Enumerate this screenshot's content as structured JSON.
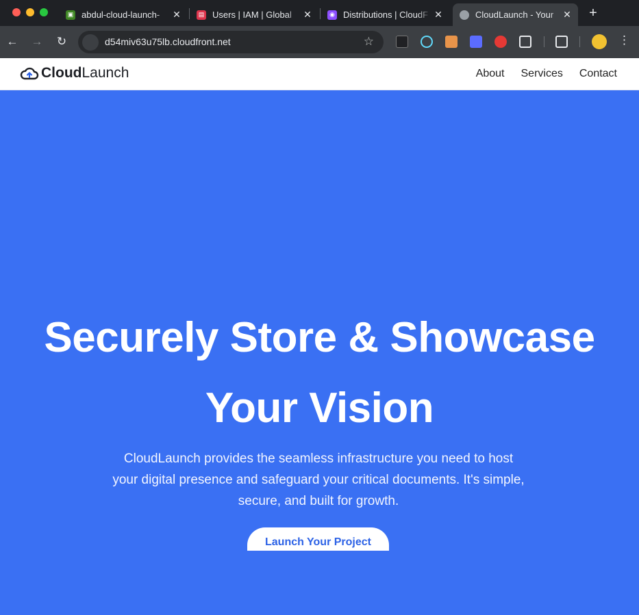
{
  "browser": {
    "tabs": [
      {
        "title": "abdul-cloud-launch-",
        "favicon": "s3-bucket-icon",
        "favicon_color": "#3f8624"
      },
      {
        "title": "Users | IAM | Global",
        "favicon": "iam-icon",
        "favicon_color": "#dd344c"
      },
      {
        "title": "Distributions | CloudF",
        "favicon": "cloudfront-icon",
        "favicon_color": "#8c4fff"
      },
      {
        "title": "CloudLaunch - Your",
        "favicon": "globe-icon",
        "favicon_color": "#9aa0a6",
        "active": true
      }
    ],
    "url": "d54miv63u75lb.cloudfront.net",
    "colors": {
      "titlebar": "#1f2125",
      "toolbar": "#3c3f43"
    }
  },
  "site": {
    "logo": {
      "bold": "Cloud",
      "light": "Launch"
    },
    "nav": {
      "about": "About",
      "services": "Services",
      "contact": "Contact"
    },
    "hero": {
      "title_line1": "Securely Store & Showcase",
      "title_line2": "Your Vision",
      "subtitle": "CloudLaunch provides the seamless infrastructure you need to host your digital presence and safeguard your critical documents. It's simple, secure, and built for growth.",
      "cta": "Launch Your Project"
    },
    "colors": {
      "hero_bg": "#3a70f3",
      "cta_text": "#2c62e6"
    }
  }
}
